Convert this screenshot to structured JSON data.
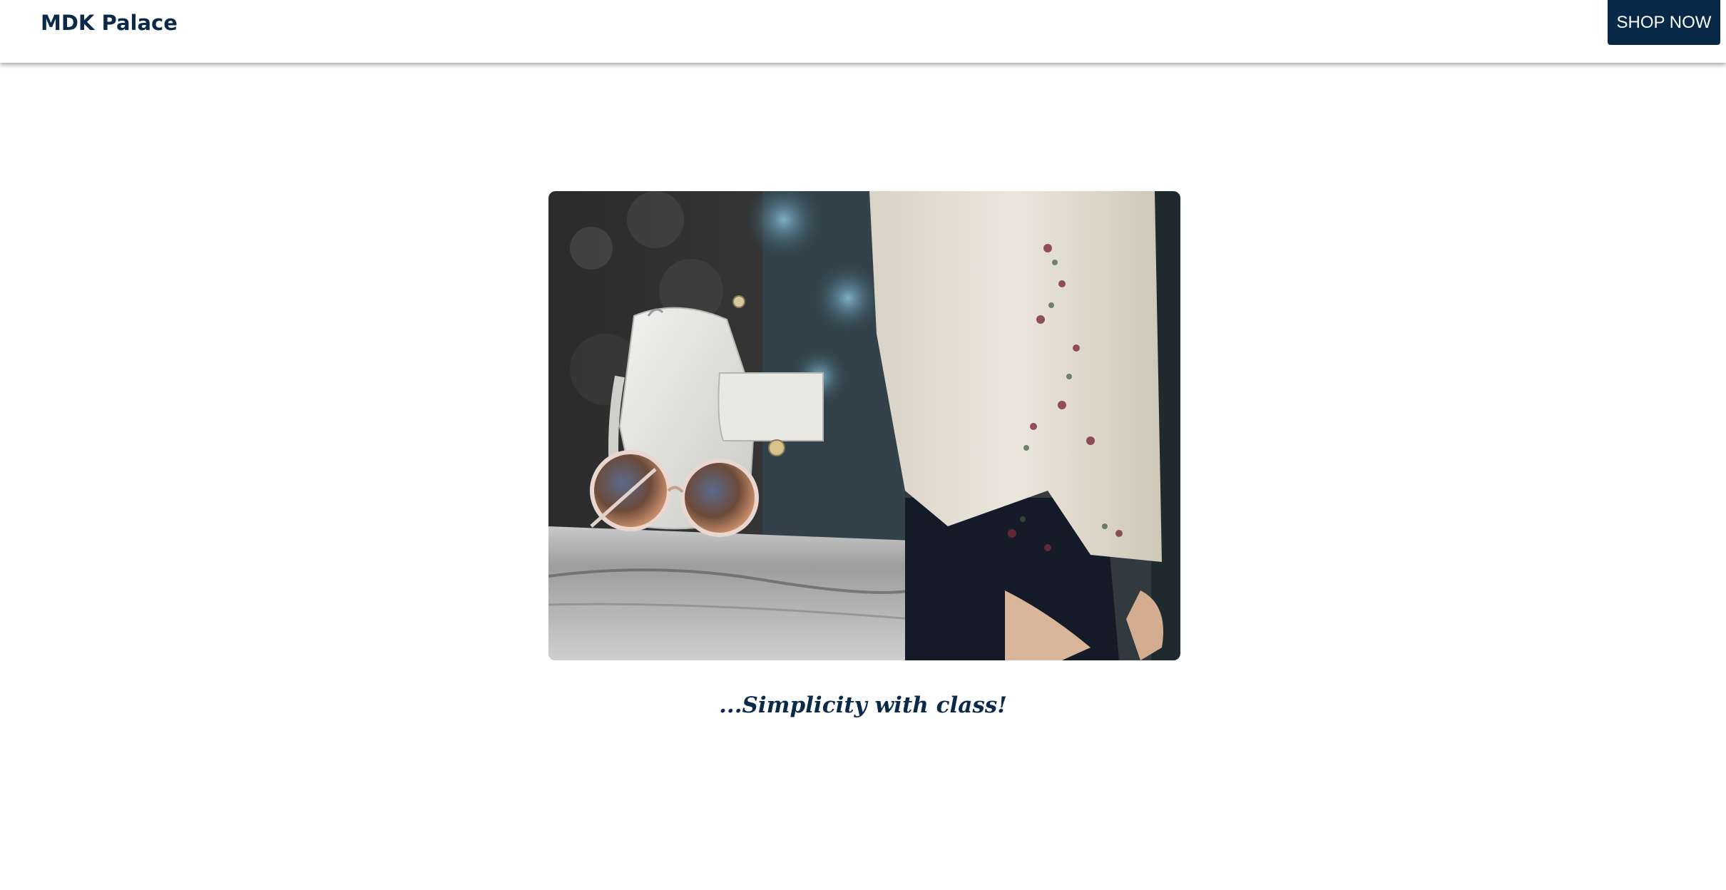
{
  "header": {
    "brand": "MDK Palace",
    "shop_button_label": "SHOP NOW"
  },
  "hero": {
    "image_alt": "White handbag and round sunglasses on a stone ledge beside a person in an embroidered blouse"
  },
  "tagline": "...Simplicity with class!",
  "colors": {
    "brand": "#0b2a49",
    "button_bg": "#072947",
    "button_text": "#ffffff",
    "background": "#ffffff"
  }
}
